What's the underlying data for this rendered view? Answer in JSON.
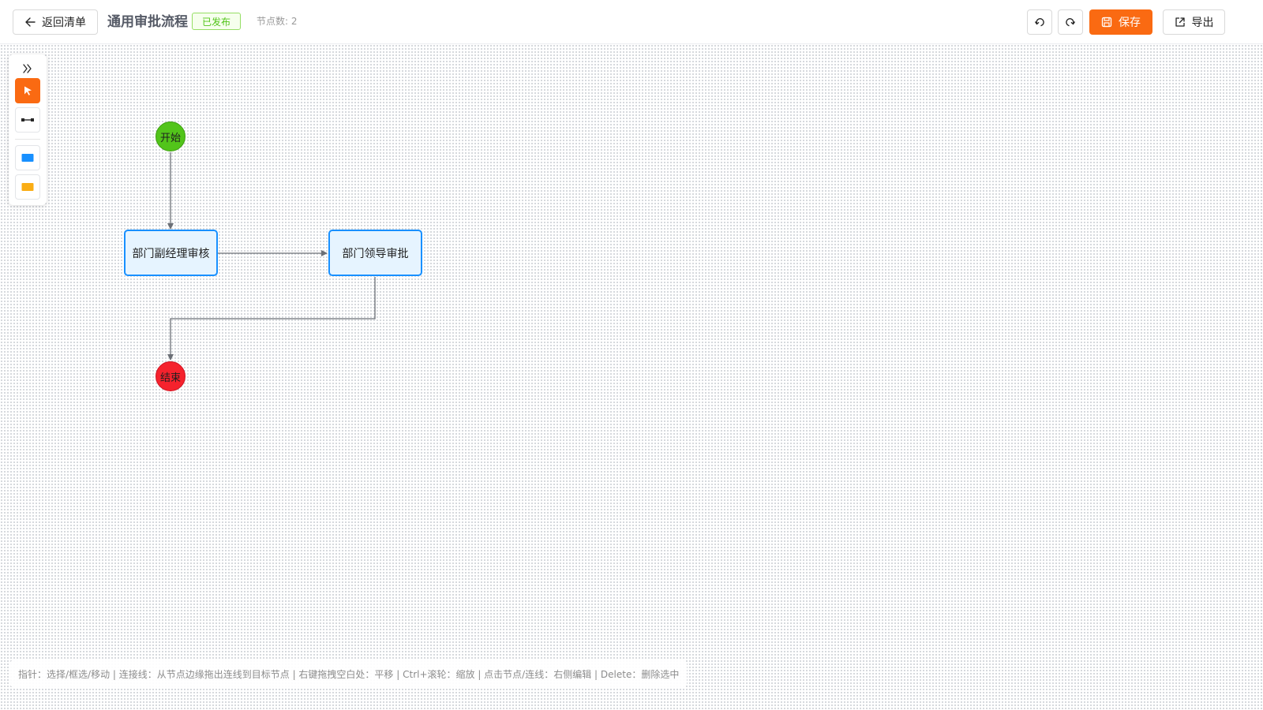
{
  "header": {
    "back_label": "返回清单",
    "title": "通用审批流程",
    "status": "已发布",
    "node_count_text": "节点数: 2",
    "save_label": "保存",
    "export_label": "导出"
  },
  "toolbox": {
    "tools": [
      {
        "name": "pointer-tool",
        "icon": "cursor-arrow-icon",
        "active": true
      },
      {
        "name": "connector-tool",
        "icon": "connector-line-icon",
        "active": false
      },
      {
        "name": "task-node-tool",
        "icon": "blue-rectangle-icon",
        "active": false
      },
      {
        "name": "gateway-node-tool",
        "icon": "yellow-rectangle-icon",
        "active": false
      }
    ]
  },
  "flow": {
    "nodes": {
      "start": "开始",
      "task1": "部门副经理审核",
      "task2": "部门领导审批",
      "end": "结束"
    },
    "edges": [
      {
        "from": "start",
        "to": "task1"
      },
      {
        "from": "task1",
        "to": "task2"
      },
      {
        "from": "task2",
        "to": "end"
      }
    ]
  },
  "hint": "指针：选择/框选/移动 | 连接线：从节点边缘拖出连线到目标节点 | 右键拖拽空白处：平移 | Ctrl+滚轮：缩放 | 点击节点/连线：右侧编辑 | Delete：删除选中",
  "colors": {
    "accent": "#fa6a12",
    "start_node": "#52c41a",
    "end_node": "#f5222d",
    "task_border": "#1890ff",
    "task_fill": "#e6f4ff",
    "published": "#52c41a",
    "edge": "#6b6f76"
  }
}
